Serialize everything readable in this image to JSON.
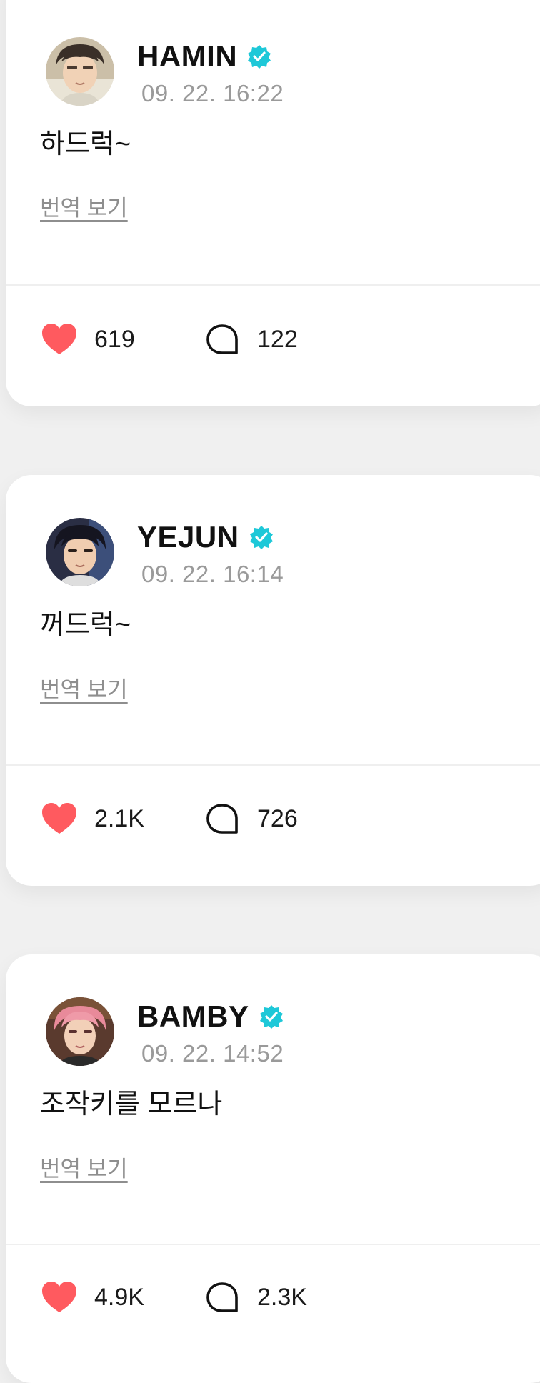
{
  "colors": {
    "verified": "#1ec8d8",
    "heart": "#ff5a5f",
    "timestamp": "#9a9a9a",
    "link": "#8e8e8e"
  },
  "posts": [
    {
      "author": "HAMIN",
      "verified_icon": "verified-badge-icon",
      "timestamp": "09. 22. 16:22",
      "text": "하드럭~",
      "translate_label": "번역 보기",
      "likes": "619",
      "comments": "122"
    },
    {
      "author": "YEJUN",
      "verified_icon": "verified-badge-icon",
      "timestamp": "09. 22. 16:14",
      "text": "꺼드럭~",
      "translate_label": "번역 보기",
      "likes": "2.1K",
      "comments": "726"
    },
    {
      "author": "BAMBY",
      "verified_icon": "verified-badge-icon",
      "timestamp": "09. 22. 14:52",
      "text": "조작키를 모르나",
      "translate_label": "번역 보기",
      "likes": "4.9K",
      "comments": "2.3K"
    }
  ]
}
